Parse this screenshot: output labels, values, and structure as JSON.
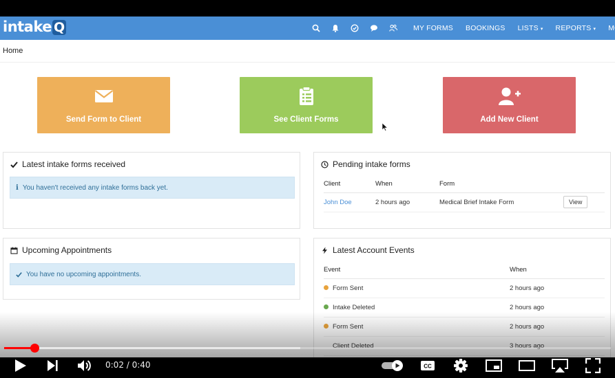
{
  "app": {
    "logo_text": "intake",
    "logo_q": "Q",
    "nav_links": [
      {
        "label": "MY FORMS",
        "caret": ""
      },
      {
        "label": "BOOKINGS",
        "caret": ""
      },
      {
        "label": "LISTS",
        "caret": "▾"
      },
      {
        "label": "REPORTS",
        "caret": "▾"
      },
      {
        "label": "MORE",
        "caret": "▾"
      }
    ],
    "nav_icons": [
      "search-icon",
      "bell-icon",
      "check-circle-icon",
      "chat-icon",
      "users-icon"
    ],
    "breadcrumb": "Home",
    "tiles": {
      "send": {
        "label": "Send Form to Client",
        "icon": "envelope-icon",
        "color": "#eeb05a"
      },
      "see": {
        "label": "See Client Forms",
        "icon": "clipboard-icon",
        "color": "#9ccb5c"
      },
      "add": {
        "label": "Add New Client",
        "icon": "user-plus-icon",
        "color": "#d9676a"
      }
    },
    "latest_forms": {
      "title": "Latest intake forms received",
      "alert": "You haven't received any intake forms back yet."
    },
    "pending": {
      "title": "Pending intake forms",
      "columns": [
        "Client",
        "When",
        "Form"
      ],
      "rows": [
        {
          "client": "John Doe",
          "when": "2 hours ago",
          "form": "Medical Brief Intake Form",
          "action": "View"
        }
      ]
    },
    "appointments": {
      "title": "Upcoming Appointments",
      "alert": "You have no upcoming appointments."
    },
    "events": {
      "title": "Latest Account Events",
      "columns": [
        "Event",
        "When"
      ],
      "rows": [
        {
          "event": "Form Sent",
          "when": "2 hours ago",
          "color": "#e8a33d"
        },
        {
          "event": "Intake Deleted",
          "when": "2 hours ago",
          "color": "#6aa84f"
        },
        {
          "event": "Form Sent",
          "when": "2 hours ago",
          "color": "#e8a33d"
        },
        {
          "event": "Client Deleted",
          "when": "3 hours ago",
          "color": ""
        }
      ]
    }
  },
  "player": {
    "time": "0:02 / 0:40",
    "progress": 0.05,
    "colors": {
      "accent": "#ff0000"
    }
  }
}
